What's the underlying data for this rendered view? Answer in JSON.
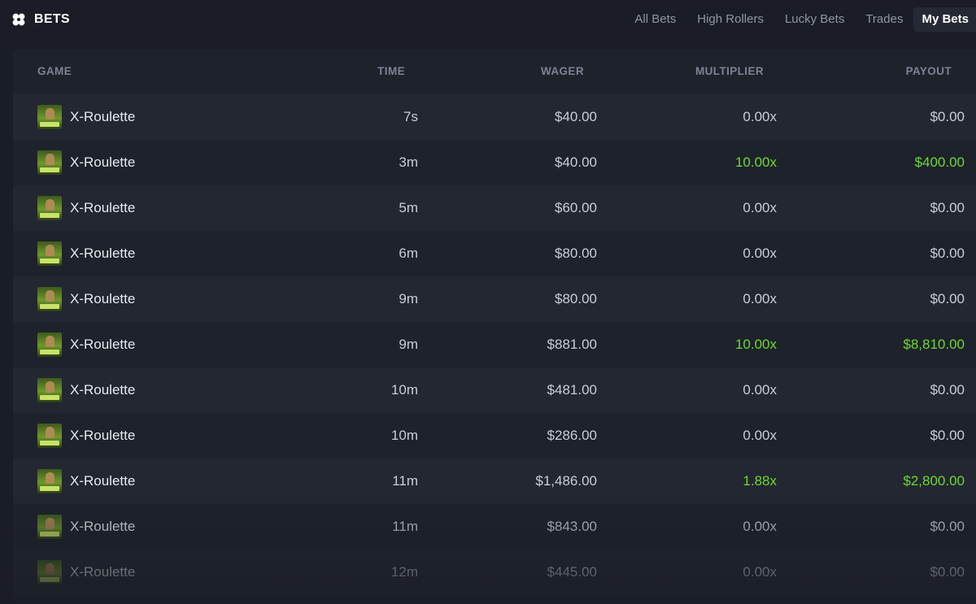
{
  "header": {
    "title": "BETS",
    "icon": "clover-icon"
  },
  "tabs": [
    {
      "label": "All Bets",
      "active": false
    },
    {
      "label": "High Rollers",
      "active": false
    },
    {
      "label": "Lucky Bets",
      "active": false
    },
    {
      "label": "Trades",
      "active": false
    },
    {
      "label": "My Bets",
      "active": true
    }
  ],
  "table": {
    "columns": {
      "game": "GAME",
      "time": "TIME",
      "wager": "WAGER",
      "multiplier": "MULTIPLIER",
      "payout": "PAYOUT"
    },
    "rows": [
      {
        "game": "X-Roulette",
        "time": "7s",
        "wager": "$40.00",
        "multiplier": "0.00x",
        "payout": "$0.00",
        "win": false
      },
      {
        "game": "X-Roulette",
        "time": "3m",
        "wager": "$40.00",
        "multiplier": "10.00x",
        "payout": "$400.00",
        "win": true
      },
      {
        "game": "X-Roulette",
        "time": "5m",
        "wager": "$60.00",
        "multiplier": "0.00x",
        "payout": "$0.00",
        "win": false
      },
      {
        "game": "X-Roulette",
        "time": "6m",
        "wager": "$80.00",
        "multiplier": "0.00x",
        "payout": "$0.00",
        "win": false
      },
      {
        "game": "X-Roulette",
        "time": "9m",
        "wager": "$80.00",
        "multiplier": "0.00x",
        "payout": "$0.00",
        "win": false
      },
      {
        "game": "X-Roulette",
        "time": "9m",
        "wager": "$881.00",
        "multiplier": "10.00x",
        "payout": "$8,810.00",
        "win": true
      },
      {
        "game": "X-Roulette",
        "time": "10m",
        "wager": "$481.00",
        "multiplier": "0.00x",
        "payout": "$0.00",
        "win": false
      },
      {
        "game": "X-Roulette",
        "time": "10m",
        "wager": "$286.00",
        "multiplier": "0.00x",
        "payout": "$0.00",
        "win": false
      },
      {
        "game": "X-Roulette",
        "time": "11m",
        "wager": "$1,486.00",
        "multiplier": "1.88x",
        "payout": "$2,800.00",
        "win": true
      },
      {
        "game": "X-Roulette",
        "time": "11m",
        "wager": "$843.00",
        "multiplier": "0.00x",
        "payout": "$0.00",
        "win": false
      },
      {
        "game": "X-Roulette",
        "time": "12m",
        "wager": "$445.00",
        "multiplier": "0.00x",
        "payout": "$0.00",
        "win": false
      }
    ]
  },
  "colors": {
    "background": "#1a1d25",
    "panel": "#1e222b",
    "row_alt": "#232731",
    "win": "#6fd82f",
    "muted": "#7c8394"
  }
}
